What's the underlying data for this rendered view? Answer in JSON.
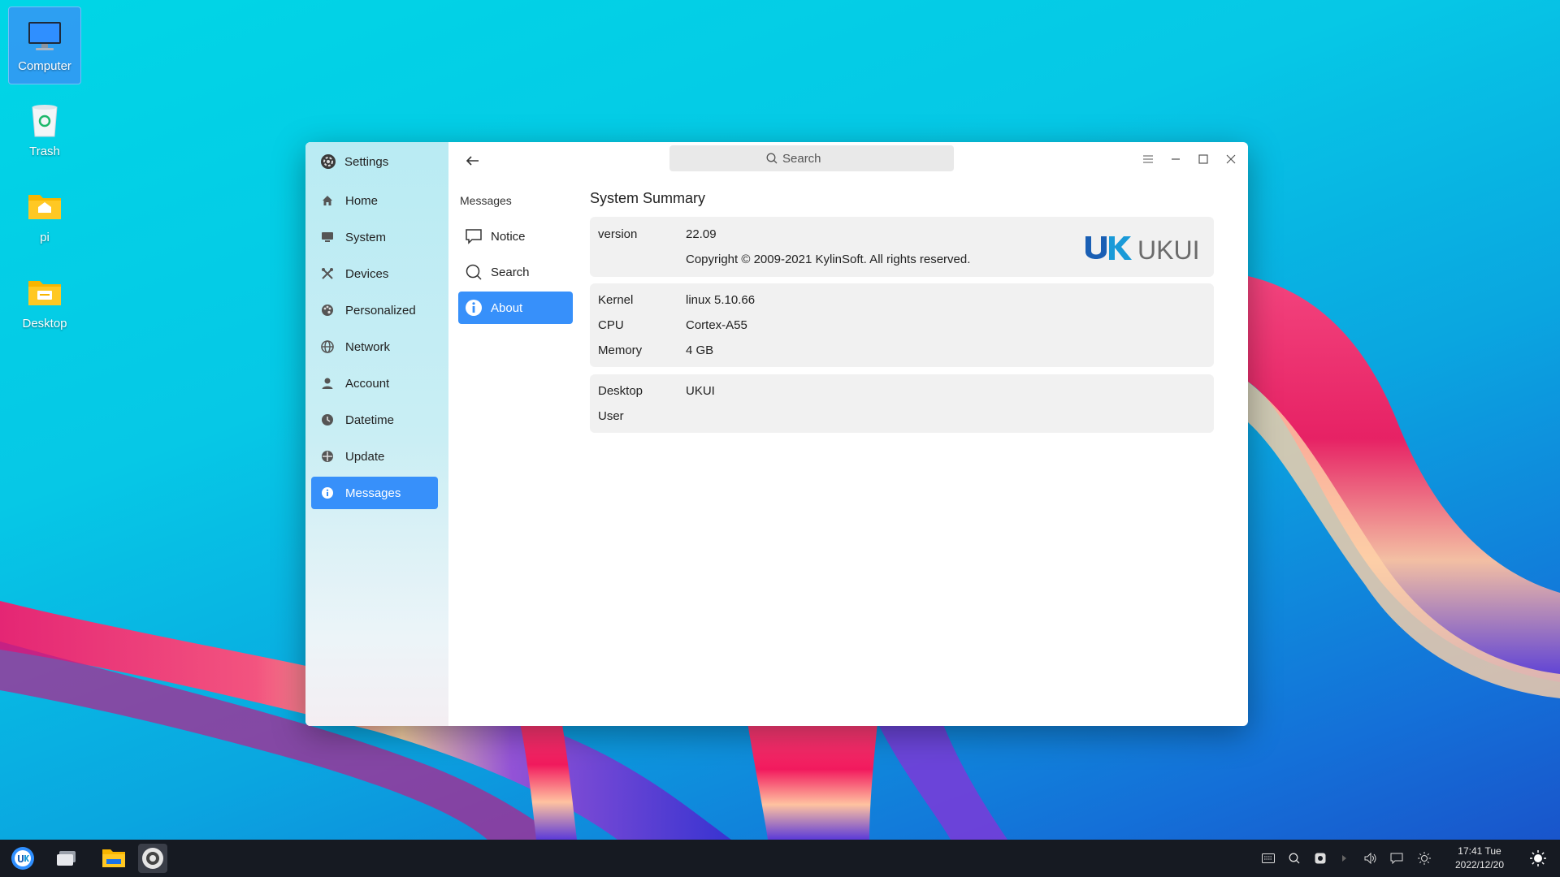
{
  "desktop": {
    "icons": [
      {
        "label": "Computer"
      },
      {
        "label": "Trash"
      },
      {
        "label": "pi"
      },
      {
        "label": "Desktop"
      }
    ]
  },
  "window": {
    "app_title": "Settings",
    "sidebar": {
      "items": [
        {
          "label": "Home",
          "icon": "home-icon"
        },
        {
          "label": "System",
          "icon": "monitor-icon"
        },
        {
          "label": "Devices",
          "icon": "devices-icon"
        },
        {
          "label": "Personalized",
          "icon": "palette-icon"
        },
        {
          "label": "Network",
          "icon": "network-icon"
        },
        {
          "label": "Account",
          "icon": "user-icon"
        },
        {
          "label": "Datetime",
          "icon": "clock-icon"
        },
        {
          "label": "Update",
          "icon": "update-icon"
        },
        {
          "label": "Messages",
          "icon": "info-icon"
        }
      ],
      "active": "Messages"
    },
    "subpanel": {
      "heading": "Messages",
      "items": [
        {
          "label": "Notice"
        },
        {
          "label": "Search"
        },
        {
          "label": "About"
        }
      ],
      "active": "About"
    },
    "search": {
      "placeholder": "Search"
    },
    "content": {
      "title": "System Summary",
      "version_card": {
        "version_key": "version",
        "version_value": "22.09",
        "copyright": "Copyright © 2009-2021 KylinSoft. All rights reserved.",
        "logo_text": "UKUI"
      },
      "hardware_card": [
        {
          "key": "Kernel",
          "value": "linux 5.10.66"
        },
        {
          "key": "CPU",
          "value": "Cortex-A55"
        },
        {
          "key": "Memory",
          "value": "4 GB"
        }
      ],
      "desktop_card": [
        {
          "key": "Desktop",
          "value": "UKUI"
        },
        {
          "key": "User",
          "value": ""
        }
      ]
    }
  },
  "taskbar": {
    "clock_time": "17:41 Tue",
    "clock_date": "2022/12/20"
  },
  "colors": {
    "accent": "#3790fa",
    "taskbar": "#161a22"
  }
}
